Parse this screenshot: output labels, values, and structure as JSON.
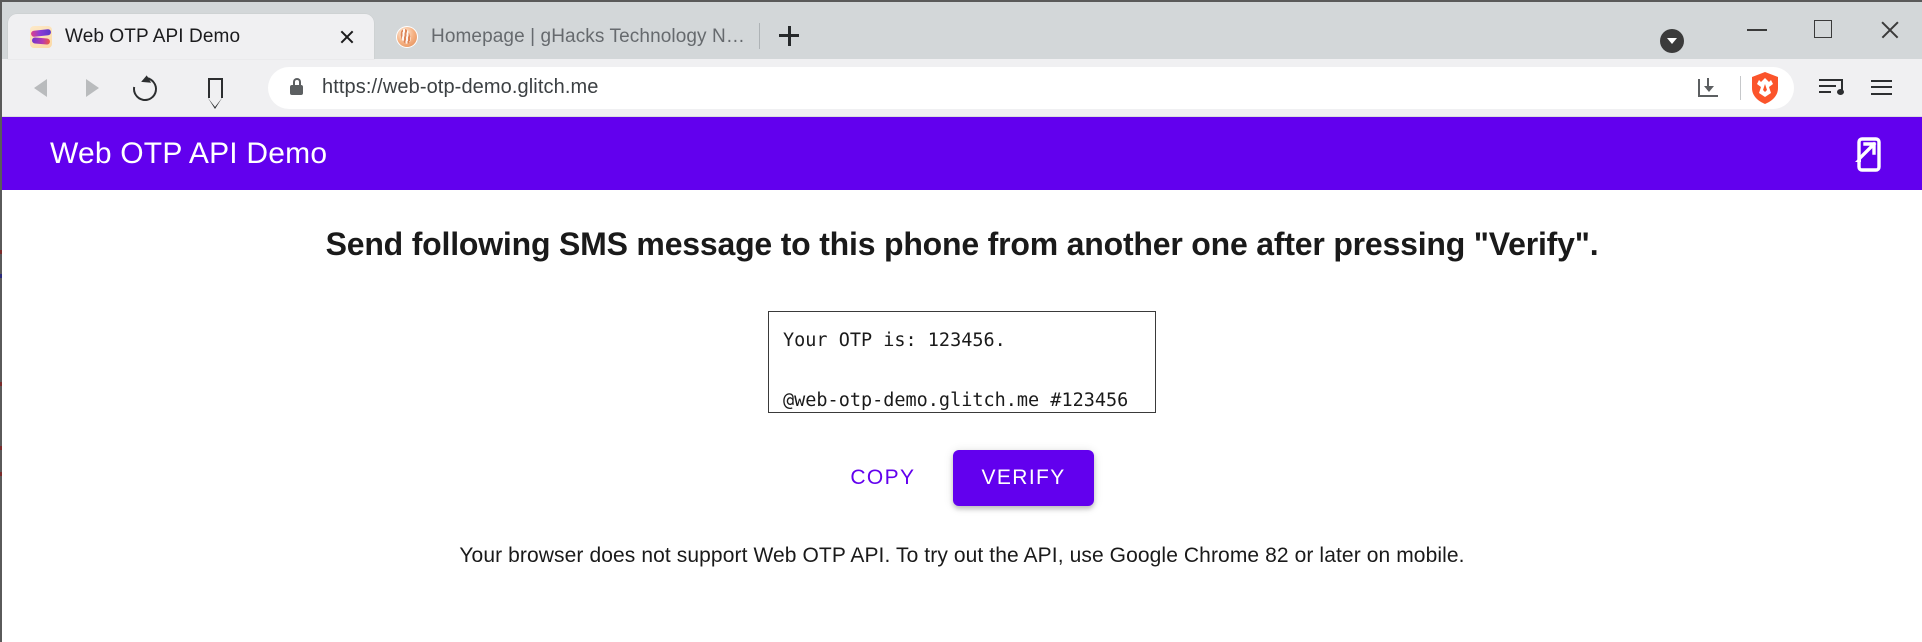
{
  "browser": {
    "tabs": [
      {
        "title": "Web OTP API Demo",
        "favicon": "glitch-fish-icon",
        "active": true,
        "close_label": ""
      },
      {
        "title": "Homepage | gHacks Technology News",
        "favicon": "ghacks-icon",
        "active": false
      }
    ],
    "new_tab_label": "",
    "window_controls": {
      "chevron_label": "",
      "minimize_label": "",
      "maximize_label": "",
      "close_label": ""
    },
    "nav": {
      "back_label": "",
      "forward_label": "",
      "reload_label": "",
      "bookmark_label": ""
    },
    "omnibox": {
      "url": "https://web-otp-demo.glitch.me",
      "placeholder": "Search or enter address",
      "lock_icon": "lock-icon",
      "install_icon": "install-app-icon",
      "brave_icon": "brave-shield-icon"
    },
    "toolbar_right": {
      "playlist_label": "",
      "menu_label": ""
    }
  },
  "page": {
    "app_title": "Web OTP API Demo",
    "header_icon": "phone-link-icon",
    "heading": "Send following SMS message to this phone from another one after pressing \"Verify\".",
    "otp_message": "Your OTP is: 123456.\n\n@web-otp-demo.glitch.me #123456",
    "buttons": {
      "copy": "COPY",
      "verify": "VERIFY"
    },
    "footer": "Your browser does not support Web OTP API. To try out the API, use Google Chrome 82 or later on mobile."
  },
  "colors": {
    "brand_purple": "#6200ee",
    "brave_orange": "#fb542b",
    "chrome_tabbar": "#d3d7d9",
    "chrome_toolbar": "#f0f0f2"
  }
}
